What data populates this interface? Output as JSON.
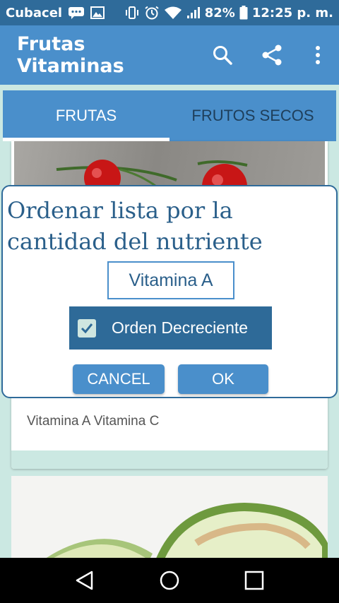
{
  "status_bar": {
    "carrier": "Cubacel",
    "battery": "82%",
    "time": "12:25 p. m."
  },
  "app_bar": {
    "title": "Frutas Vitaminas",
    "icons": [
      "search-icon",
      "share-icon",
      "more-vertical-icon"
    ]
  },
  "tabs": [
    {
      "label": "FRUTAS",
      "active": true
    },
    {
      "label": "FRUTOS SECOS",
      "active": false
    }
  ],
  "cards": [
    {
      "vitamins": "Vitamina A Vitamina C"
    }
  ],
  "dialog": {
    "title_line1": "Ordenar lista por la",
    "title_line2": "cantidad del nutriente",
    "nutrient": "Vitamina A",
    "order_label": "Orden Decreciente",
    "order_checked": true,
    "cancel_label": "CANCEL",
    "ok_label": "OK"
  },
  "nav_bar": {
    "icons": [
      "back-icon",
      "home-icon",
      "recents-icon"
    ]
  },
  "colors": {
    "status_bar": "#2f6b9a",
    "app_bar": "#4a8fcb",
    "background": "#cbe8e2",
    "dialog_text": "#2a5f8a",
    "toggle_bg": "#2e6a98"
  }
}
